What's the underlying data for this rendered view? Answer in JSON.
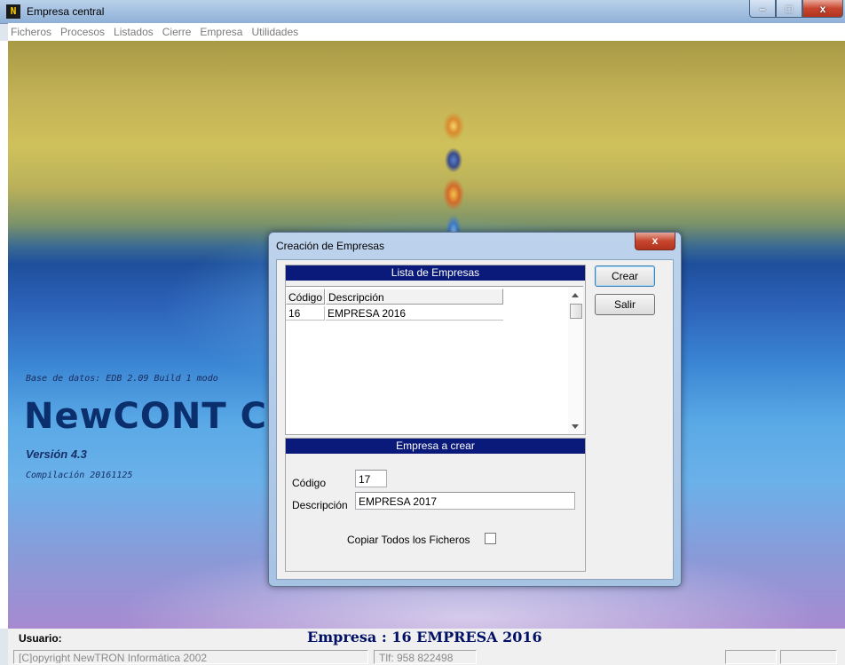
{
  "window": {
    "title": "Empresa central",
    "icon_text": "N",
    "controls": {
      "minimize": "–",
      "maximize": "□",
      "close": "x"
    }
  },
  "menu": [
    "Ficheros",
    "Procesos",
    "Listados",
    "Cierre",
    "Empresa",
    "Utilidades"
  ],
  "splash": {
    "database": "Base de datos: EDB 2.09 Build 1 modo",
    "app_name": "NewCONT C",
    "version": "Versión 4.3",
    "build": "Compilación 20161125"
  },
  "dialog": {
    "title": "Creación de Empresas",
    "close_label": "x",
    "list_group": {
      "header": "Lista de Empresas",
      "columns": [
        "Código",
        "Descripción"
      ],
      "rows": [
        {
          "codigo": "16",
          "descripcion": "EMPRESA 2016"
        }
      ]
    },
    "create_group": {
      "header": "Empresa a crear",
      "codigo_label": "Código",
      "codigo_value": "17",
      "descripcion_label": "Descripción",
      "descripcion_value": "EMPRESA 2017",
      "copy_label": "Copiar Todos los Ficheros",
      "copy_checked": false
    },
    "buttons": {
      "crear": "Crear",
      "salir": "Salir"
    }
  },
  "status": {
    "usuario_label": "Usuario:",
    "empresa": "Empresa : 16 EMPRESA 2016",
    "copyright": "[C]opyright NewTRON Informática 2002",
    "phone": "Tlf: 958 822498"
  }
}
